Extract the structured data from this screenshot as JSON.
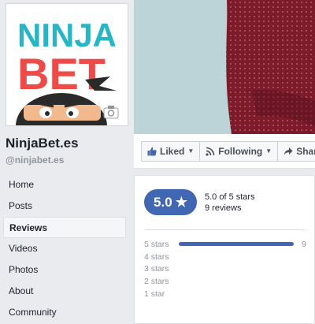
{
  "page": {
    "name": "NinjaBet.es",
    "handle": "@ninjabet.es",
    "logo_line1": "NINJA",
    "logo_line2": "BET"
  },
  "nav": {
    "items": [
      {
        "label": "Home",
        "active": false
      },
      {
        "label": "Posts",
        "active": false
      },
      {
        "label": "Reviews",
        "active": true
      },
      {
        "label": "Videos",
        "active": false
      },
      {
        "label": "Photos",
        "active": false
      },
      {
        "label": "About",
        "active": false
      },
      {
        "label": "Community",
        "active": false
      }
    ]
  },
  "actions": {
    "liked": "Liked",
    "following": "Following",
    "share": "Share"
  },
  "reviews": {
    "score": "5.0",
    "star_glyph": "★",
    "summary_line1": "5.0 of 5 stars",
    "summary_line2": "9 reviews",
    "distribution": [
      {
        "label": "5 stars",
        "count": "9",
        "fraction": 1.0
      },
      {
        "label": "4 stars",
        "count": "",
        "fraction": 0
      },
      {
        "label": "3 stars",
        "count": "",
        "fraction": 0
      },
      {
        "label": "2 stars",
        "count": "",
        "fraction": 0
      },
      {
        "label": "1 star",
        "count": "",
        "fraction": 0
      }
    ]
  },
  "colors": {
    "accent": "#4267b2",
    "logo_teal": "#27b6c5",
    "logo_red": "#ee4a47",
    "shirt": "#7d1b2b"
  },
  "icons": {
    "camera": "camera-icon",
    "like": "thumbs-up-icon",
    "rss": "rss-icon",
    "share": "share-arrow-icon",
    "star": "star-icon"
  }
}
